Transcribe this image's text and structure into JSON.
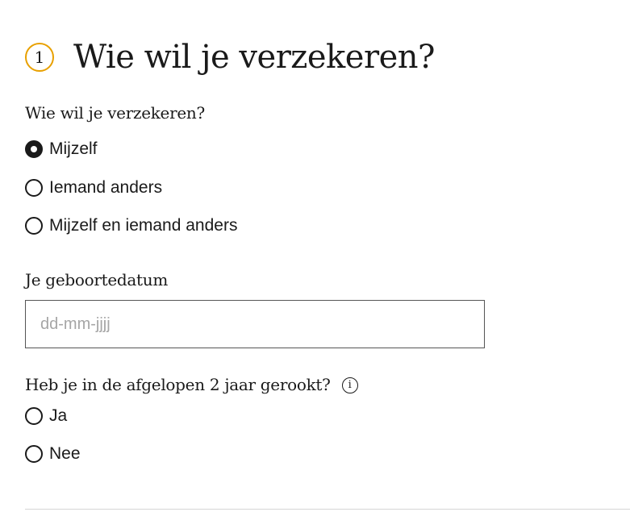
{
  "step": {
    "number": "1",
    "title": "Wie wil je verzekeren?"
  },
  "insured": {
    "question": "Wie wil je verzekeren?",
    "options": [
      {
        "label": "Mijzelf",
        "selected": true
      },
      {
        "label": "Iemand anders",
        "selected": false
      },
      {
        "label": "Mijzelf en iemand anders",
        "selected": false
      }
    ]
  },
  "birthdate": {
    "label": "Je geboortedatum",
    "value": "",
    "placeholder": "dd-mm-jjjj"
  },
  "smoking": {
    "question": "Heb je in de afgelopen 2 jaar gerookt?",
    "info_icon": "info-icon",
    "options": [
      {
        "label": "Ja",
        "selected": false
      },
      {
        "label": "Nee",
        "selected": false
      }
    ]
  },
  "colors": {
    "step_circle_border": "#e8a000",
    "text": "#1a1a1a",
    "input_border": "#555555",
    "placeholder": "#a6a6a6",
    "divider": "#d6d6d6"
  }
}
